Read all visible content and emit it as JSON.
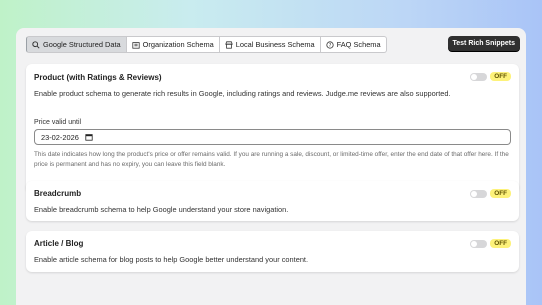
{
  "tabs": [
    {
      "label": "Google Structured Data",
      "icon": "search-icon"
    },
    {
      "label": "Organization Schema",
      "icon": "building-icon"
    },
    {
      "label": "Local Business Schema",
      "icon": "store-icon"
    },
    {
      "label": "FAQ Schema",
      "icon": "question-icon"
    }
  ],
  "test_button": "Test Rich Snippets",
  "cards": {
    "product": {
      "title": "Product (with Ratings & Reviews)",
      "desc": "Enable product schema to generate rich results in Google, including ratings and reviews. Judge.me reviews are also supported.",
      "status": "OFF",
      "field_label": "Price valid until",
      "date_value": "23-02-2026",
      "help": "This date indicates how long the product's price or offer remains valid. If you are running a sale, discount, or limited-time offer, enter the end date of that offer here. If the price is permanent and has no expiry, you can leave this field blank."
    },
    "breadcrumb": {
      "title": "Breadcrumb",
      "desc": "Enable breadcrumb schema to help Google understand your store navigation.",
      "status": "OFF"
    },
    "article": {
      "title": "Article / Blog",
      "desc": "Enable article schema for blog posts to help Google better understand your content.",
      "status": "OFF"
    }
  },
  "colors": {
    "badge_off": "#fdf27a",
    "dark_button": "#303030"
  }
}
